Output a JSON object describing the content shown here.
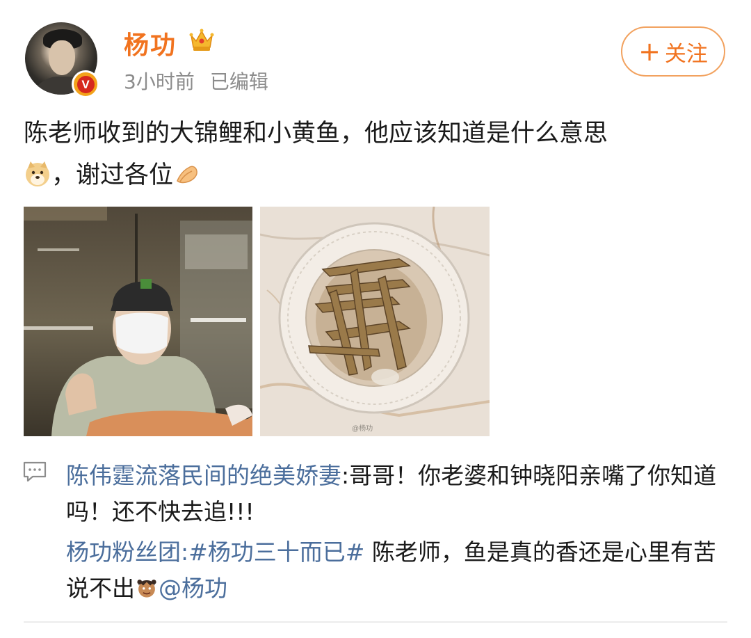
{
  "post": {
    "author": "杨功",
    "time": "3小时前",
    "edited": "已编辑",
    "follow_label": "关注",
    "text_line1": "陈老师收到的大锦鲤和小黄鱼，他应该知道是什么意思",
    "text_line2": "，谢过各位",
    "image_watermark": "@杨功"
  },
  "comments": [
    {
      "user": "陈伟霆流落民间的绝美娇妻",
      "text": ":哥哥！你老婆和钟晓阳亲嘴了你知道吗！还不快去追!!!"
    },
    {
      "user": "杨功粉丝团",
      "hashtag": ":#杨功三十而已#",
      "text": " 陈老师，鱼是真的香还是心里有苦说不出",
      "mention": "@杨功"
    }
  ],
  "icons": [
    "crown-icon",
    "verified-badge-icon",
    "doge-emoji",
    "pray-hands-emoji",
    "comment-icon",
    "cartoon-emoji"
  ],
  "colors": {
    "username": "#f1731f",
    "link": "#4b6e9c",
    "meta": "#8c8c8c"
  }
}
